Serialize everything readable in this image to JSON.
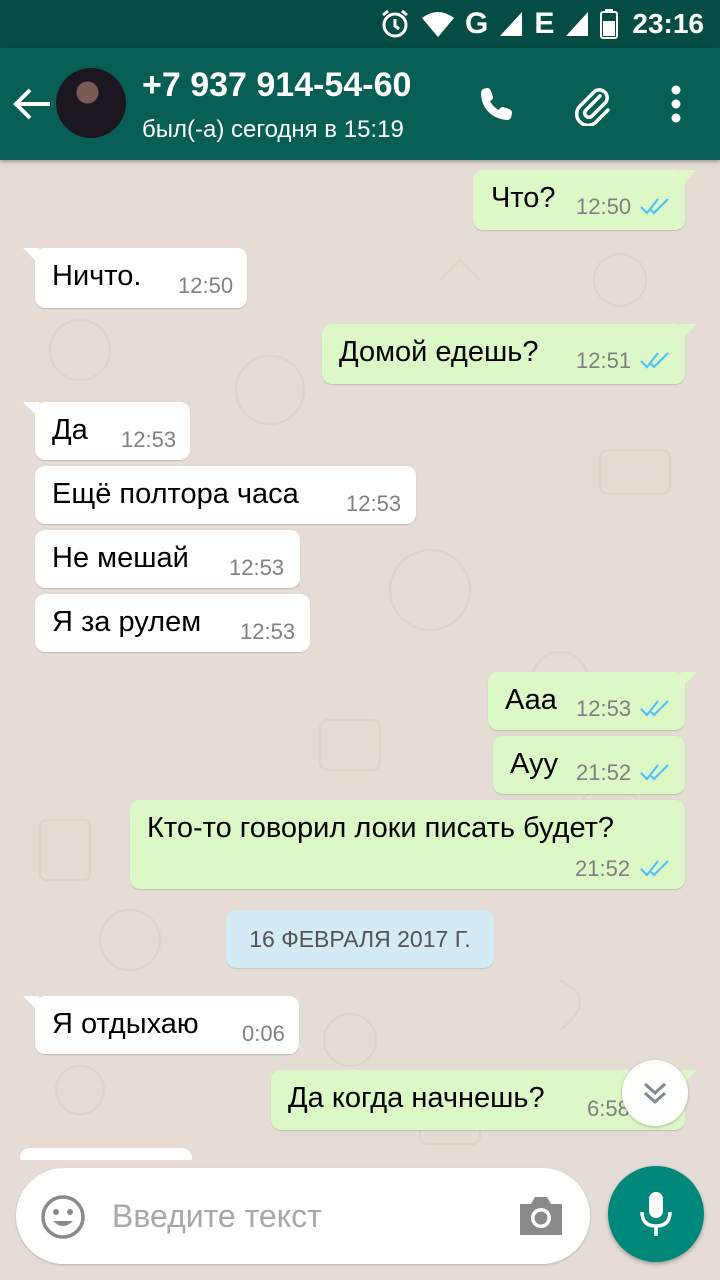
{
  "status_bar": {
    "network_g": "G",
    "network_e": "E",
    "time": "23:16",
    "icons": [
      "alarm-icon",
      "wifi-icon",
      "signal-icon",
      "signal-icon",
      "battery-icon"
    ]
  },
  "header": {
    "contact_name": "+7 937 914-54-60",
    "last_seen": "был(-а) сегодня в 15:19",
    "icons": [
      "back-arrow-icon",
      "avatar",
      "phone-icon",
      "paperclip-icon",
      "more-vert-icon"
    ]
  },
  "messages": [
    {
      "direction": "out",
      "text": "Что?",
      "time": "12:50",
      "read": true
    },
    {
      "direction": "in",
      "text": "Ничто.",
      "time": "12:50"
    },
    {
      "direction": "out",
      "text": "Домой едешь?",
      "time": "12:51",
      "read": true
    },
    {
      "direction": "in",
      "text": "Да",
      "time": "12:53"
    },
    {
      "direction": "in",
      "text": "Ещё полтора часа",
      "time": "12:53"
    },
    {
      "direction": "in",
      "text": "Не мешай",
      "time": "12:53"
    },
    {
      "direction": "in",
      "text": "Я за рулем",
      "time": "12:53"
    },
    {
      "direction": "out",
      "text": "Ааа",
      "time": "12:53",
      "read": true
    },
    {
      "direction": "out",
      "text": "Ауу",
      "time": "21:52",
      "read": true
    },
    {
      "direction": "out",
      "text": "Кто-то говорил локи писать будет?",
      "time": "21:52",
      "read": true
    },
    {
      "direction": "in",
      "text": "Я отдыхаю",
      "time": "0:06"
    },
    {
      "direction": "out",
      "text": "Да когда начнешь?",
      "time": "6:58",
      "read": true
    }
  ],
  "date_divider": "16 ФЕВРАЛЯ 2017 Г.",
  "composer": {
    "placeholder": "Введите текст",
    "icons": [
      "emoji-icon",
      "camera-icon",
      "mic-icon",
      "scroll-down-icon"
    ]
  },
  "colors": {
    "status_bar": "#054d44",
    "app_bar": "#075e54",
    "outgoing_bubble": "#dcf8c6",
    "incoming_bubble": "#ffffff",
    "read_tick": "#4fc3f7",
    "mic_button": "#00897b",
    "chat_background": "#e5ddd5"
  }
}
